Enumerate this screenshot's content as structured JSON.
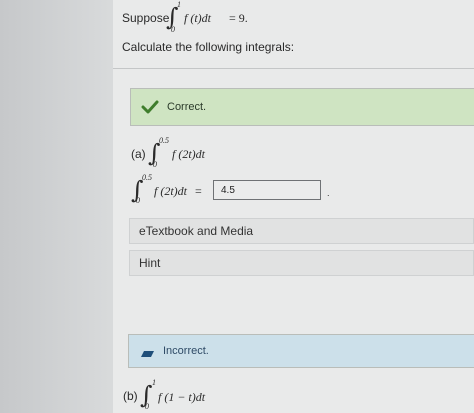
{
  "problem": {
    "suppose_label": "Suppose",
    "given_integral": {
      "lower": "0",
      "upper": "1",
      "integrand": "f (t)dt",
      "rhs": "= 9."
    },
    "instruction": "Calculate the following integrals:"
  },
  "part_a": {
    "status_text": "Correct.",
    "label": "(a)",
    "integral": {
      "lower": "0",
      "upper": "0.5",
      "integrand": "f (2t)dt"
    },
    "answer_integral": {
      "lower": "0",
      "upper": "0.5",
      "integrand": "f (2t)dt",
      "equals": "="
    },
    "answer_value": "4.5",
    "answer_suffix": ".",
    "etextbook_label": "eTextbook and Media",
    "hint_label": "Hint"
  },
  "part_b": {
    "status_text": "Incorrect.",
    "label": "(b)",
    "integral": {
      "lower": "0",
      "upper": "1",
      "integrand": "f (1 − t)dt"
    }
  },
  "colors": {
    "correct_banner": "#cfe4c2",
    "correct_check": "#3f7d2c",
    "incorrect_banner": "#cce0ea",
    "incorrect_icon": "#1f4f7a"
  },
  "icons": {
    "correct": "check-icon",
    "incorrect": "pencil-icon"
  }
}
